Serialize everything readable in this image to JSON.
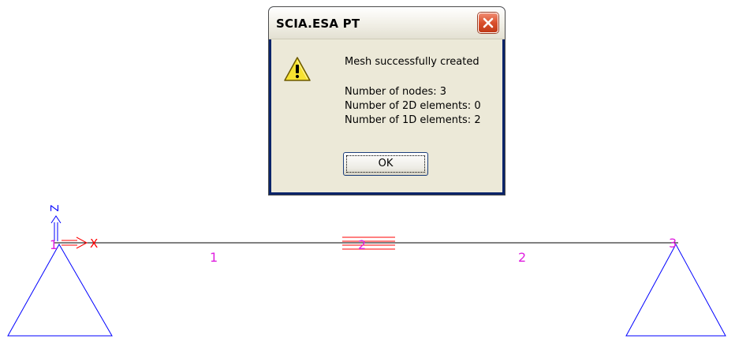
{
  "dialog": {
    "title": "SCIA.ESA PT",
    "message": "Mesh successfully created",
    "nodes_line": "Number of nodes: 3",
    "elements_2d_line": "Number of 2D elements: 0",
    "elements_1d_line": "Number of 1D elements: 2",
    "ok_label": "OK"
  },
  "model": {
    "axis_labels": {
      "z": "Z",
      "x": "X"
    },
    "node_labels": [
      "1",
      "2",
      "3"
    ],
    "member_labels": [
      "1",
      "2"
    ]
  },
  "colors": {
    "node_label": "#e020e0",
    "support": "#0000ff",
    "member": "#000000",
    "hinge": "#ff0000",
    "axis_x": "#ff0000",
    "axis_z": "#0000ff",
    "dialog_face": "#ece9d8"
  }
}
